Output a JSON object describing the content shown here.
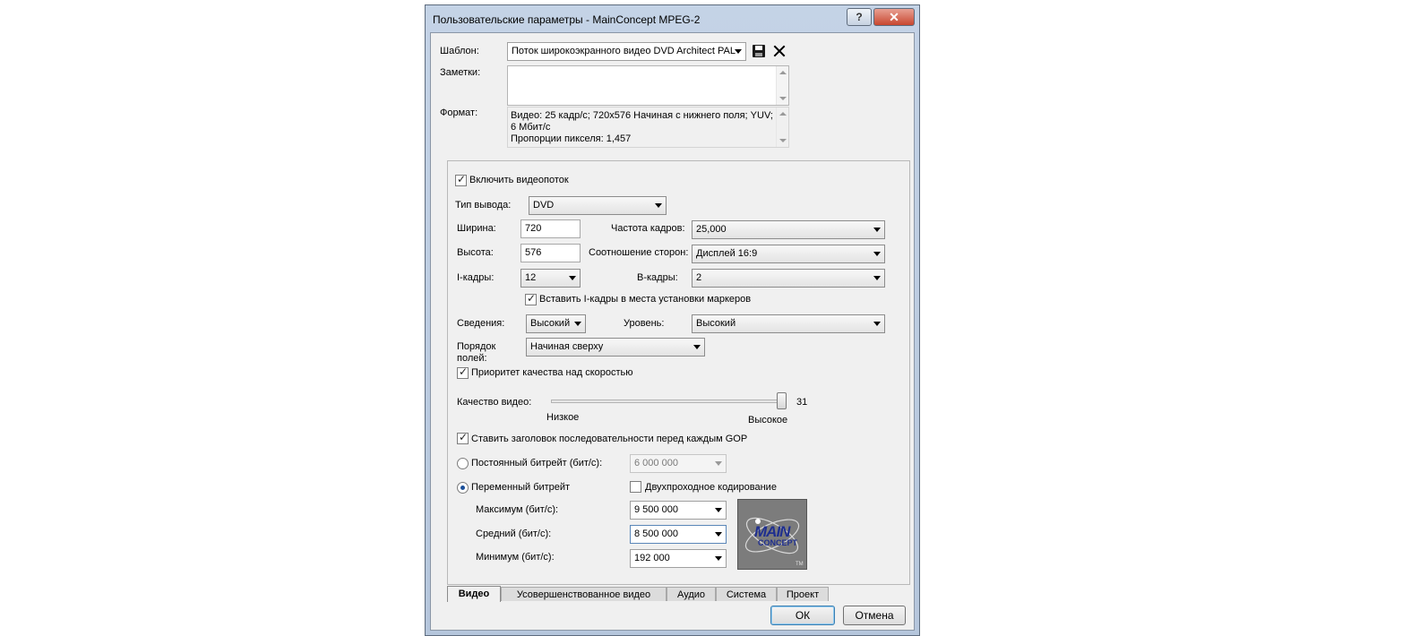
{
  "window": {
    "title": "Пользовательские параметры - MainConcept MPEG-2",
    "help_glyph": "?",
    "close_glyph": "✕"
  },
  "top": {
    "template_label": "Шаблон:",
    "template_value": "Поток широкоэкранного видео DVD Architect PAL",
    "notes_label": "Заметки:",
    "notes_value": "",
    "format_label": "Формат:",
    "format_lines": [
      "Видео: 25 кадр/с; 720х576 Начиная с нижнего поля; YUV;",
      "6 Мбит/с",
      "Пропорции пикселя: 1,457"
    ]
  },
  "video": {
    "enable_stream": {
      "label": "Включить видеопоток",
      "checked": true
    },
    "output_type_label": "Тип вывода:",
    "output_type_value": "DVD",
    "width_label": "Ширина:",
    "width_value": "720",
    "height_label": "Высота:",
    "height_value": "576",
    "frame_rate_label": "Частота кадров:",
    "frame_rate_value": "25,000",
    "aspect_label": "Соотношение сторон:",
    "aspect_value": "Дисплей 16:9",
    "iframes_label": "I-кадры:",
    "iframes_value": "12",
    "bframes_label": "B-кадры:",
    "bframes_value": "2",
    "insert_iframes": {
      "label": "Вставить I-кадры в места установки маркеров",
      "checked": true
    },
    "profile_label": "Сведения:",
    "profile_value": "Высокий",
    "level_label": "Уровень:",
    "level_value": "Высокий",
    "field_order_label_1": "Порядок",
    "field_order_label_2": "полей:",
    "field_order_value": "Начиная сверху",
    "quality_priority": {
      "label": "Приоритет качества над скоростью",
      "checked": true
    },
    "quality_label": "Качество видео:",
    "quality_value": "31",
    "quality_fraction": 1.0,
    "quality_low": "Низкое",
    "quality_high": "Высокое",
    "seq_header": {
      "label": "Ставить заголовок последовательности перед каждым GOP",
      "checked": true
    },
    "cbr": {
      "label": "Постоянный битрейт (бит/с):",
      "selected": false,
      "value": "6 000 000"
    },
    "vbr": {
      "label": "Переменный битрейт",
      "selected": true
    },
    "two_pass": {
      "label": "Двухпроходное кодирование",
      "checked": false
    },
    "max_label": "Максимум (бит/с):",
    "max_value": "9 500 000",
    "avg_label": "Средний (бит/с):",
    "avg_value": "8 500 000",
    "min_label": "Минимум (бит/с):",
    "min_value": "192 000",
    "logo_line1": "MAIN",
    "logo_line2": "CONCEPT",
    "logo_tm": "TM"
  },
  "tabs": [
    "Видео",
    "Усовершенствованное видео",
    "Аудио",
    "Система",
    "Проект"
  ],
  "buttons": {
    "ok": "ОК",
    "cancel": "Отмена"
  },
  "colors": {
    "title_bar": "#c4d3e6",
    "close_button": "#c84730",
    "logo_text": "#1f2f8f",
    "radio_dot": "#1b4f99"
  }
}
